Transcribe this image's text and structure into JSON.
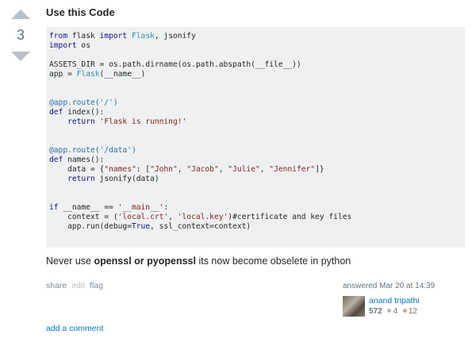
{
  "vote": {
    "count": "3",
    "up_icon": "triangle-up-icon",
    "down_icon": "triangle-down-icon",
    "arrow_color": "#bbc0c4"
  },
  "post": {
    "title": "Use this Code",
    "code_lines": [
      "from flask import Flask, jsonify",
      "import os",
      "",
      "ASSETS_DIR = os.path.dirname(os.path.abspath(__file__))",
      "app = Flask(__name__)",
      "",
      "",
      "@app.route('/')",
      "def index():",
      "    return 'Flask is running!'",
      "",
      "",
      "@app.route('/data')",
      "def names():",
      "    data = {\"names\": [\"John\", \"Jacob\", \"Julie\", \"Jennifer\"]}",
      "    return jsonify(data)",
      "",
      "",
      "if __name__ == '__main__':",
      "    context = ('local.crt', 'local.key')#certificate and key files",
      "    app.run(debug=True, ssl_context=context)"
    ],
    "answer_prefix": "Never use ",
    "answer_bold": "openssl or pyopenssl",
    "answer_suffix": " its now become obselete in python"
  },
  "menu": {
    "share": "share",
    "edit": "edit",
    "flag": "flag"
  },
  "user": {
    "action_time": "answered Mar 20 at 14:39",
    "name": "anand tripathi",
    "reputation": "572",
    "silver_badges": "4",
    "bronze_badges": "12",
    "link_color": "#0077cc"
  },
  "comments": {
    "add_label": "add a comment"
  }
}
